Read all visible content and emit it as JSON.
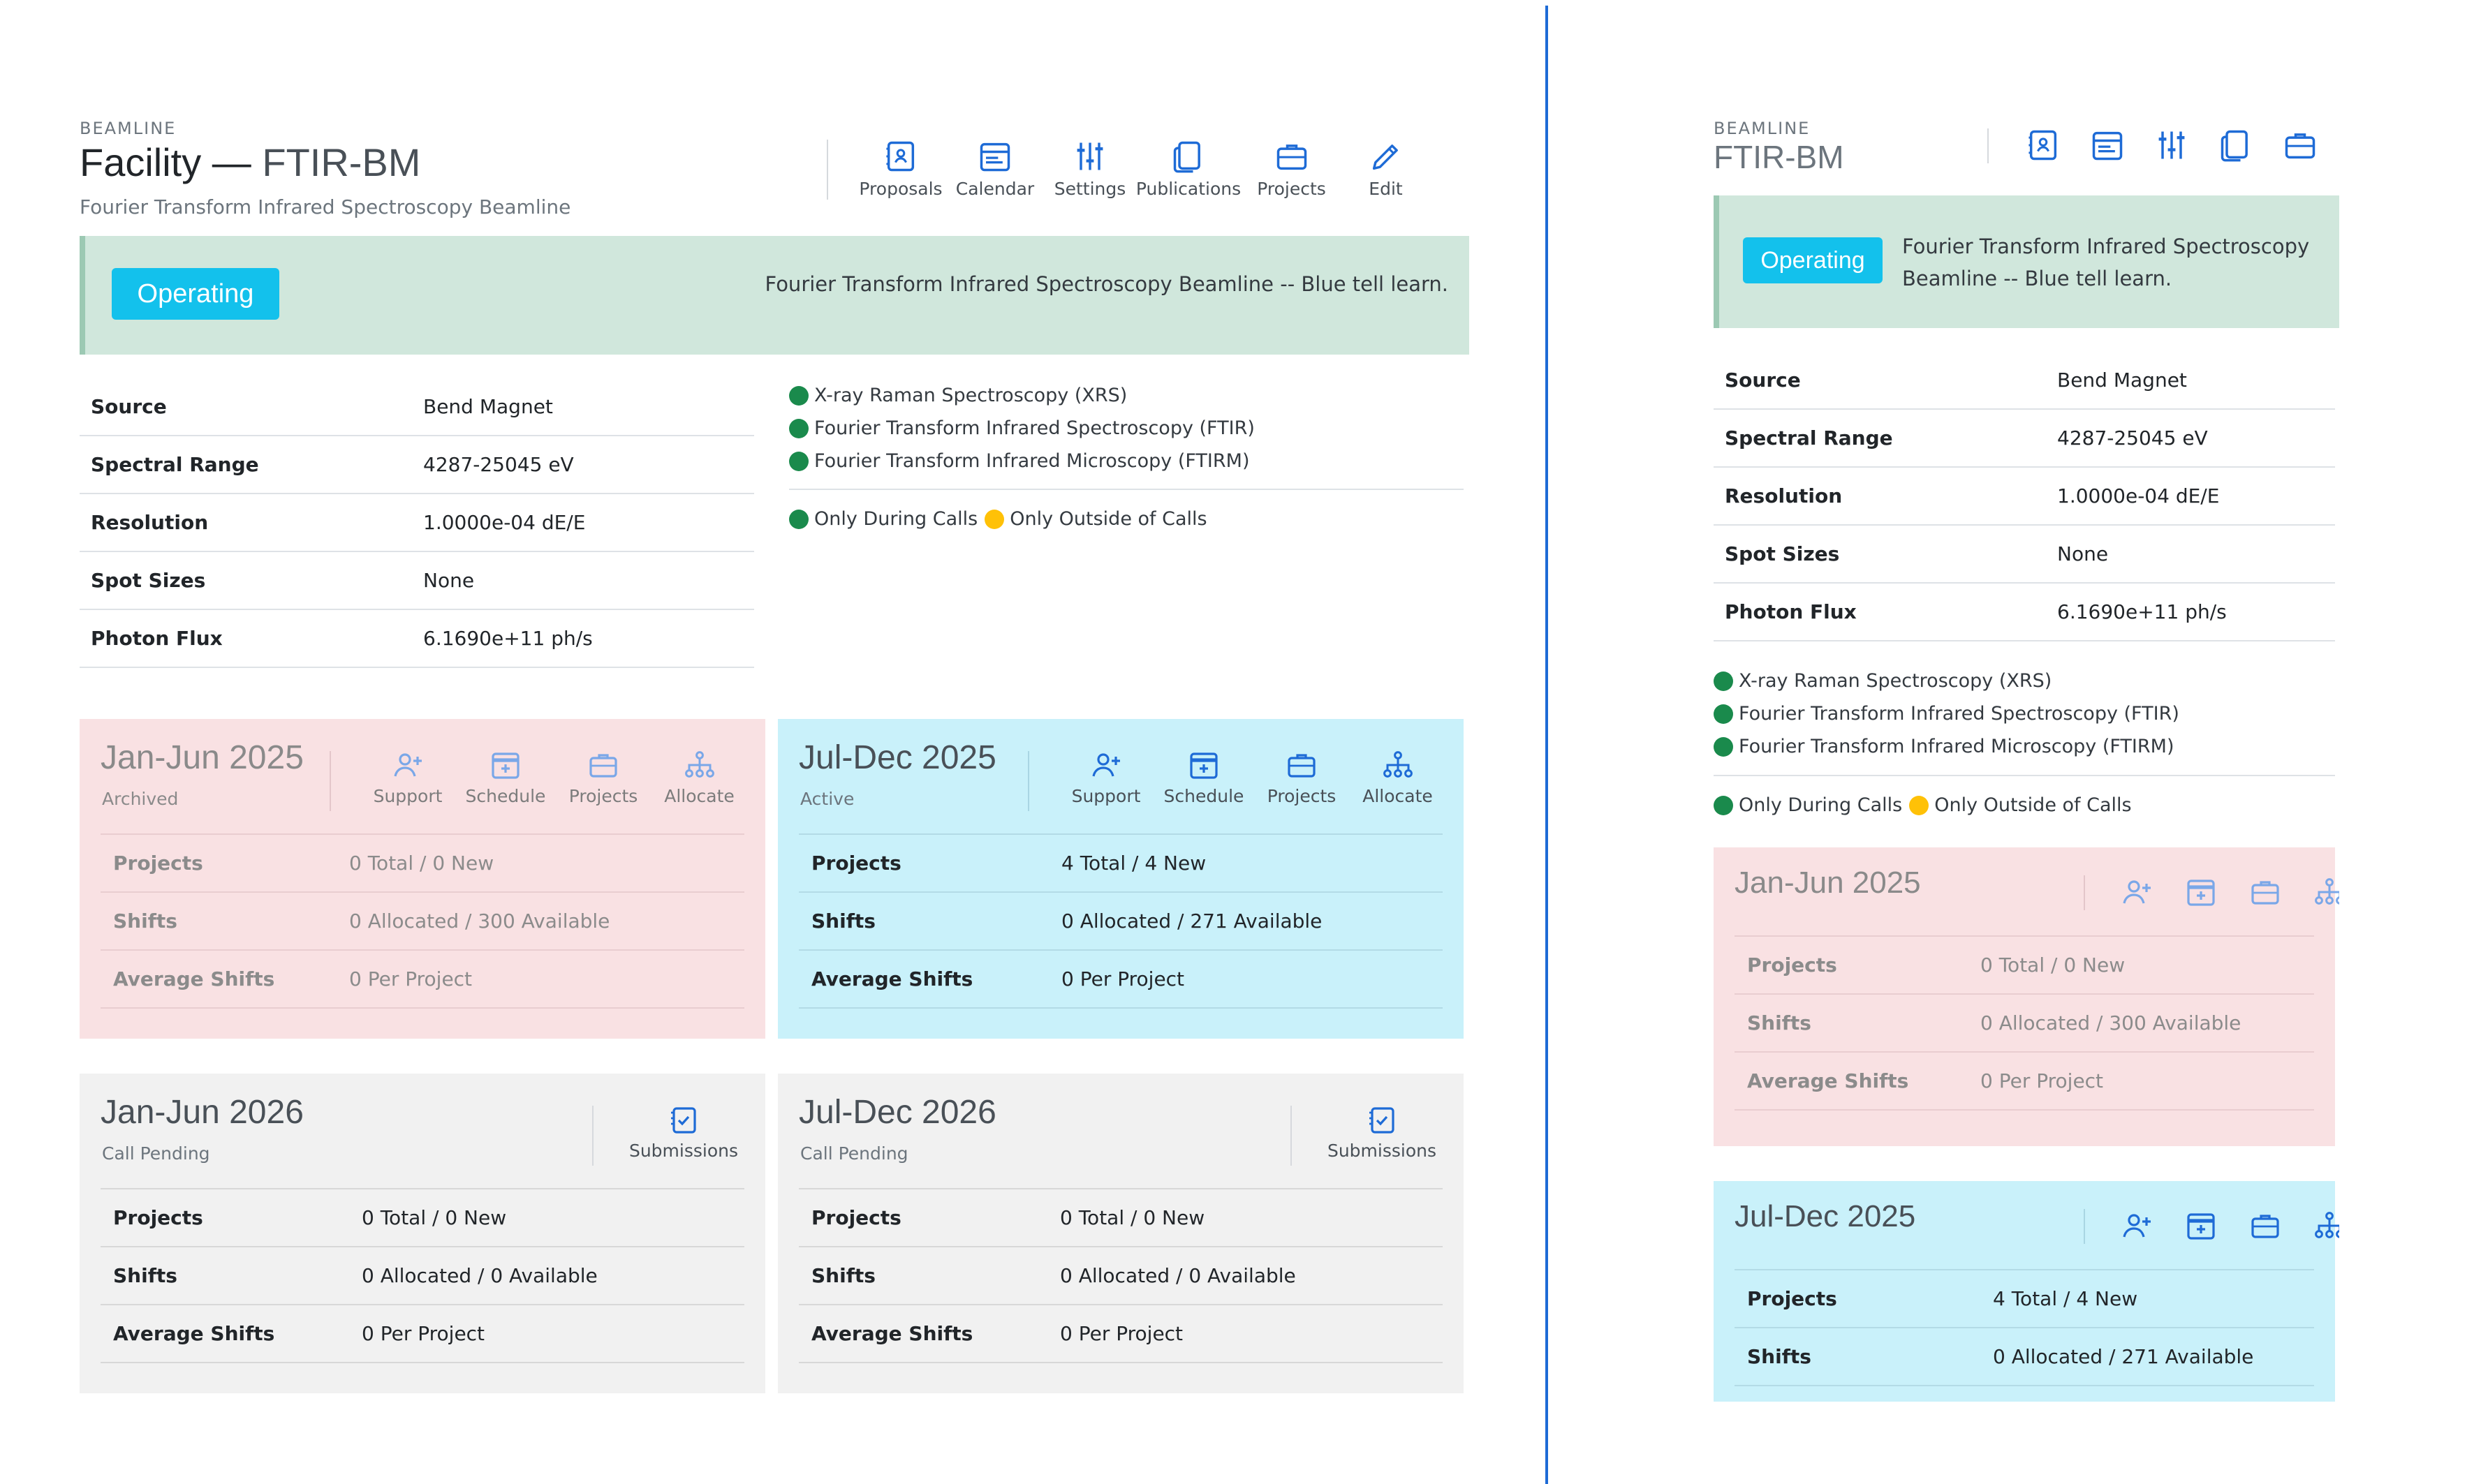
{
  "header": {
    "eyebrow": "BEAMLINE",
    "facility_label": "Facility —",
    "code": "FTIR-BM",
    "subtitle": "Fourier Transform Infrared Spectroscopy Beamline"
  },
  "toolbar": [
    {
      "label": "Proposals",
      "icon": "proposals-icon"
    },
    {
      "label": "Calendar",
      "icon": "calendar-icon"
    },
    {
      "label": "Settings",
      "icon": "sliders-icon"
    },
    {
      "label": "Publications",
      "icon": "publications-icon"
    },
    {
      "label": "Projects",
      "icon": "briefcase-icon"
    },
    {
      "label": "Edit",
      "icon": "pencil-icon"
    }
  ],
  "status": {
    "badge": "Operating",
    "text": "Fourier Transform Infrared Spectroscopy Beamline -- Blue tell learn.",
    "text_line1": "Fourier Transform Infrared Spectroscopy",
    "text_line2": "Beamline -- Blue tell learn."
  },
  "properties": [
    {
      "key": "Source",
      "value": "Bend Magnet"
    },
    {
      "key": "Spectral Range",
      "value": "4287-25045 eV"
    },
    {
      "key": "Resolution",
      "value": "1.0000e-04 dE/E"
    },
    {
      "key": "Spot Sizes",
      "value": "None"
    },
    {
      "key": "Photon Flux",
      "value": "6.1690e+11 ph/s"
    }
  ],
  "techniques": [
    "X-ray Raman Spectroscopy (XRS)",
    "Fourier Transform Infrared Spectroscopy (FTIR)",
    "Fourier Transform Infrared Microscopy (FTIRM)"
  ],
  "legend": {
    "during": "Only During Calls",
    "outside": "Only Outside of Calls"
  },
  "colors": {
    "green": "#1a8a4c",
    "yellow": "#ffc107",
    "accent": "#1e6bd6",
    "badge": "#13c1ec"
  },
  "cycle_labels": {
    "projects": "Projects",
    "shifts": "Shifts",
    "average": "Average Shifts",
    "support": "Support",
    "schedule": "Schedule",
    "projects_tool": "Projects",
    "allocate": "Allocate",
    "submissions": "Submissions"
  },
  "cycles": [
    {
      "name": "Jan-Jun 2025",
      "state": "Archived",
      "projects": "0 Total / 0 New",
      "shifts": "0 Allocated / 300 Available",
      "average": "0 Per Project"
    },
    {
      "name": "Jul-Dec 2025",
      "state": "Active",
      "projects": "4 Total / 4 New",
      "shifts": "0 Allocated / 271 Available",
      "average": "0 Per Project"
    },
    {
      "name": "Jan-Jun 2026",
      "state": "Call Pending",
      "projects": "0 Total / 0 New",
      "shifts": "0 Allocated / 0 Available",
      "average": "0 Per Project"
    },
    {
      "name": "Jul-Dec 2026",
      "state": "Call Pending",
      "projects": "0 Total / 0 New",
      "shifts": "0 Allocated / 0 Available",
      "average": "0 Per Project"
    }
  ]
}
